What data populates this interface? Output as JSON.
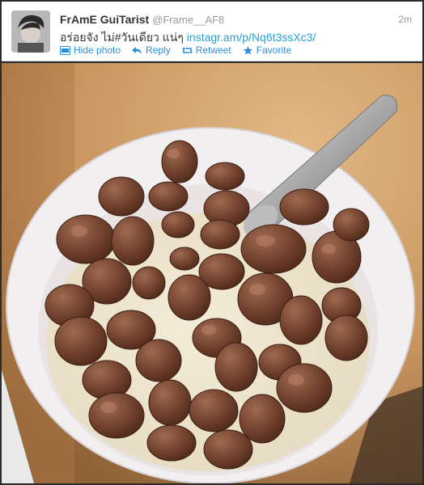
{
  "tweet": {
    "display_name": "FrAmE GuiTarist",
    "handle": "@Frame__AF8",
    "time": "2m",
    "text": "อร่อยจัง ไม่#วันเดียว แน่ๆ",
    "link": "instagr.am/p/Nq6t3ssXc3/"
  },
  "actions": {
    "hide_photo": "Hide photo",
    "reply": "Reply",
    "retweet": "Retweet",
    "favorite": "Favorite"
  },
  "icons": {
    "hide_photo": "photo-icon",
    "reply": "reply-arrow-icon",
    "retweet": "retweet-icon",
    "favorite": "star-icon"
  },
  "colors": {
    "link": "#2a9fd6",
    "name": "#333333",
    "meta": "#999999"
  }
}
